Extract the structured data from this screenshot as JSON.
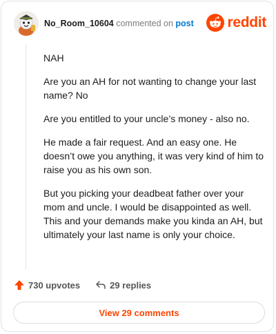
{
  "comment": {
    "username": "No_Room_10604",
    "action_text": "commented on",
    "post_link": "post",
    "brand": "reddit",
    "paragraphs": [
      "NAH",
      "Are you an AH for not wanting to change your last name? No",
      "Are you entitled to your uncle’s money - also no.",
      "He made a fair request. And an easy one. He doesn’t owe you anything, it was very kind of him to raise you as his own son.",
      "But you picking your deadbeat father over your mom and uncle. I would be disappointed as well. This and your demands make you kinda an AH, but ultimately your last name is only your choice."
    ]
  },
  "actions": {
    "upvotes": "730 upvotes",
    "replies": "29 replies"
  },
  "footer": {
    "view_label": "View 29 comments"
  },
  "colors": {
    "accent": "#ff4500",
    "link": "#0079d3"
  },
  "icons": [
    "avatar",
    "reddit-logo-icon",
    "upvote-arrow-icon",
    "reply-arrow-icon"
  ]
}
